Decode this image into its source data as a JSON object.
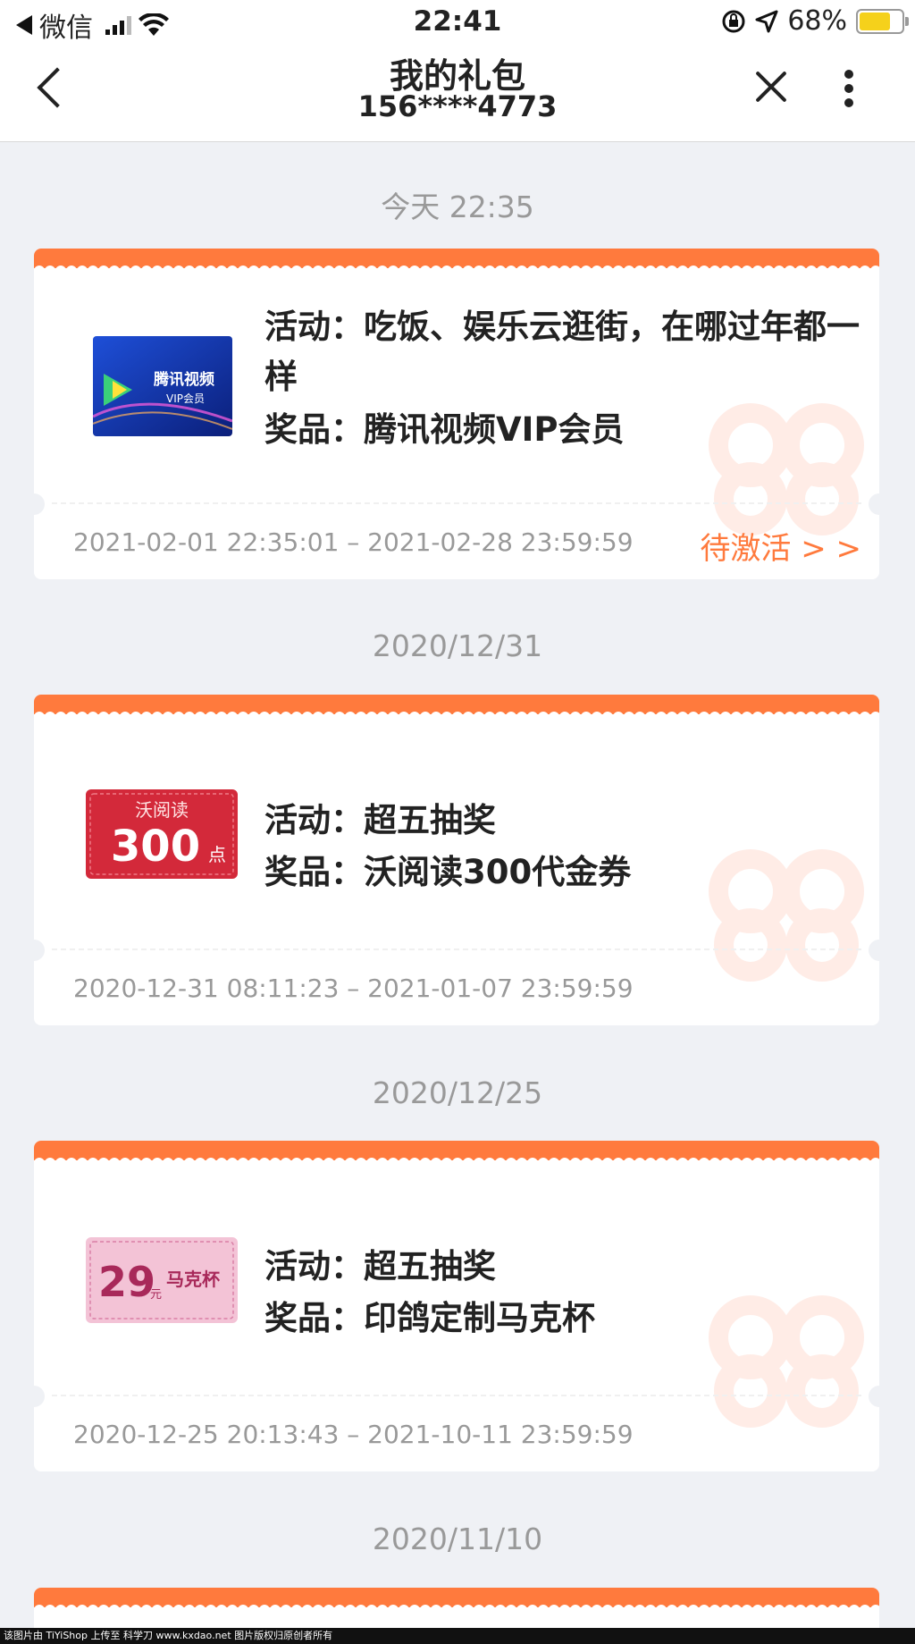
{
  "status_bar": {
    "app": "微信",
    "time": "22:41",
    "battery": "68%"
  },
  "nav": {
    "title": "我的礼包",
    "phone": "156****4773"
  },
  "gifts": [
    {
      "date_header": "今天 22:35",
      "activity_label": "活动：",
      "activity": "吃饭、娱乐云逛街，在哪过年都一样",
      "prize_label": "奖品：",
      "prize": "腾讯视频VIP会员",
      "period": "2021-02-01 22:35:01 – 2021-02-28 23:59:59",
      "action": "待激活 > >",
      "image": {
        "line1": "腾讯视频",
        "line2": "VIP会员"
      }
    },
    {
      "date_header": "2020/12/31",
      "activity_label": "活动：",
      "activity": "超五抽奖",
      "prize_label": "奖品：",
      "prize": "沃阅读300代金券",
      "period": "2020-12-31 08:11:23 – 2021-01-07 23:59:59",
      "image": {
        "line1": "沃阅读",
        "amount": "300",
        "unit": "点"
      }
    },
    {
      "date_header": "2020/12/25",
      "activity_label": "活动：",
      "activity": "超五抽奖",
      "prize_label": "奖品：",
      "prize": "印鸽定制马克杯",
      "period": "2020-12-25 20:13:43 – 2021-10-11 23:59:59",
      "image": {
        "amount": "29",
        "unit": "元",
        "name": "马克杯"
      }
    }
  ],
  "last_date_header": "2020/11/10",
  "footer": "该图片由 TiYiShop 上传至 科学刀 www.kxdao.net 图片版权归原创者所有",
  "colors": {
    "accent": "#ff7a3d",
    "background": "#eff1f5",
    "muted": "#999999"
  }
}
